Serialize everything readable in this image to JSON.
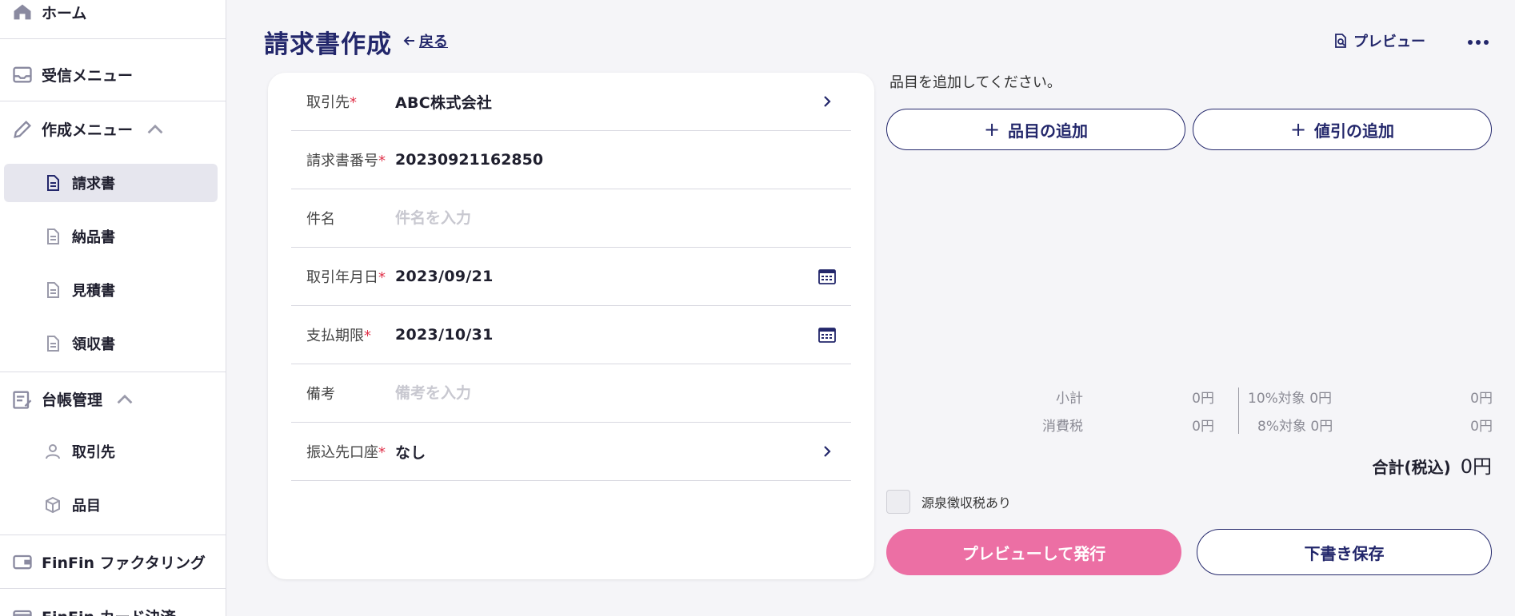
{
  "sidebar": {
    "home": "ホーム",
    "inbox": "受信メニュー",
    "create_menu": "作成メニュー",
    "invoice": "請求書",
    "delivery": "納品書",
    "estimate": "見積書",
    "receipt": "領収書",
    "ledger": "台帳管理",
    "clients": "取引先",
    "items": "品目",
    "factoring": "FinFin ファクタリング",
    "card": "FinFin カード決済"
  },
  "header": {
    "title": "請求書作成",
    "back": "戻る",
    "preview": "プレビュー"
  },
  "form": {
    "client_label": "取引先",
    "client_value": "ABC株式会社",
    "number_label": "請求書番号",
    "number_value": "20230921162850",
    "subject_label": "件名",
    "subject_placeholder": "件名を入力",
    "date_label": "取引年月日",
    "date_value": "2023/09/21",
    "due_label": "支払期限",
    "due_value": "2023/10/31",
    "memo_label": "備考",
    "memo_placeholder": "備考を入力",
    "account_label": "振込先口座",
    "account_value": "なし",
    "required_mark": "*"
  },
  "items_panel": {
    "instruction": "品目を追加してください。",
    "add_item": "品目の追加",
    "add_discount": "値引の追加",
    "plus": "+"
  },
  "totals": {
    "subtotal_label": "小計",
    "subtotal_value": "0円",
    "tax_label": "消費税",
    "tax_value": "0円",
    "tax10_label": "10%対象 0円",
    "tax10_value": "0円",
    "tax8_label": "8%対象 0円",
    "tax8_value": "0円",
    "total_label": "合計(税込)",
    "total_value": "0円"
  },
  "withholding_label": "源泉徴収税あり",
  "actions": {
    "issue": "プレビューして発行",
    "save_draft": "下書き保存"
  },
  "colors": {
    "navy": "#23276b",
    "pink": "#ec6fa4",
    "required": "#e0334b"
  }
}
